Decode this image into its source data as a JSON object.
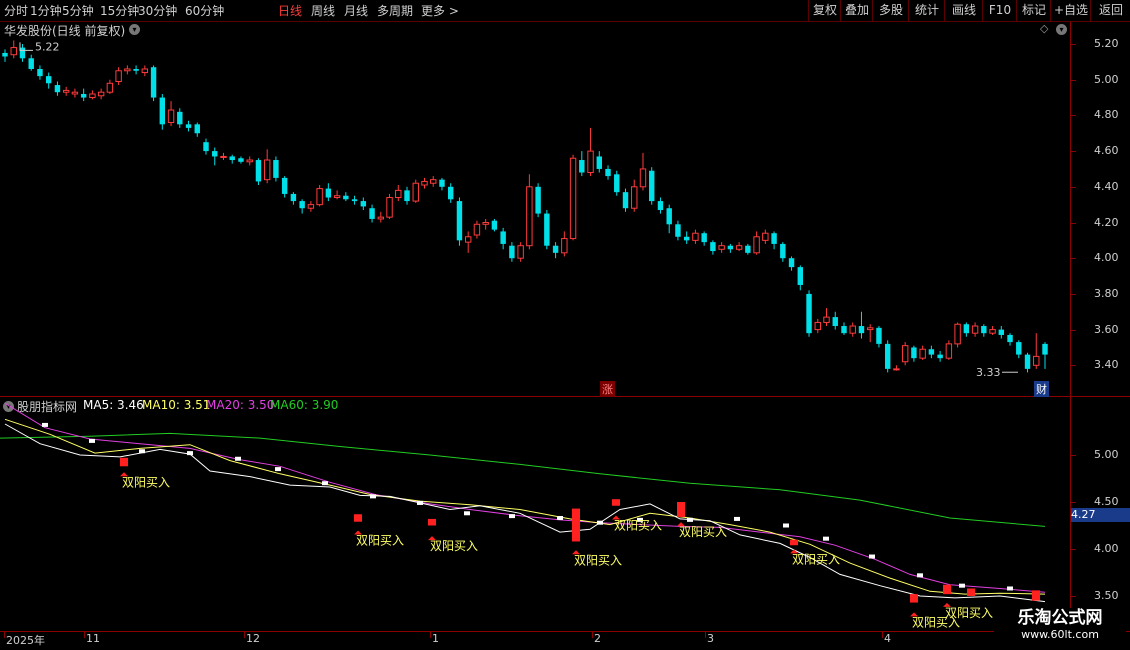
{
  "toolbar": {
    "left": [
      "分时",
      "1分钟",
      "5分钟",
      "15分钟",
      "30分钟",
      "60分钟",
      "日线",
      "周线",
      "月线",
      "多周期",
      "更多 >"
    ],
    "active": "日线",
    "right": [
      "复权",
      "叠加",
      "多股",
      "统计",
      "画线",
      "F10",
      "标记",
      "+自选",
      "返回"
    ]
  },
  "main_panel": {
    "title": "华发股份(日线 前复权)",
    "high_label": "5.22",
    "low_label": "3.33",
    "zhang_badge": "涨",
    "cai_badge": "财",
    "y_ticks": [
      "5.20",
      "5.00",
      "4.80",
      "4.60",
      "4.40",
      "4.20",
      "4.00",
      "3.80",
      "3.60",
      "3.40"
    ]
  },
  "sub_panel": {
    "title": "股朋指标网",
    "ma5": "MA5: 3.46",
    "ma10": "MA10: 3.51",
    "ma20": "MA20: 3.50",
    "ma60": "MA60: 3.90",
    "current_value": "4.27",
    "y_ticks": [
      "5.00",
      "4.50",
      "4.00",
      "3.50"
    ],
    "signal_text": "双阳买入"
  },
  "x_axis": [
    "2025年",
    "11",
    "12",
    "1",
    "2",
    "3",
    "4"
  ],
  "watermark": {
    "line1": "乐淘公式网",
    "line2": "www.60lt.com"
  },
  "colors": {
    "up": "#ff3b3b",
    "down": "#00e0e8",
    "ma5": "#ffffff",
    "ma10": "#ffff66",
    "ma20": "#e040e0",
    "ma60": "#22cc22"
  },
  "chart_data": {
    "type": "candlestick",
    "candles": [
      [
        5.15,
        5.13,
        5.17,
        5.1
      ],
      [
        5.14,
        5.18,
        5.22,
        5.12
      ],
      [
        5.18,
        5.12,
        5.2,
        5.1
      ],
      [
        5.12,
        5.06,
        5.14,
        5.05
      ],
      [
        5.06,
        5.02,
        5.08,
        5.0
      ],
      [
        5.02,
        4.98,
        5.04,
        4.95
      ],
      [
        4.97,
        4.93,
        4.99,
        4.91
      ],
      [
        4.93,
        4.94,
        4.96,
        4.91
      ],
      [
        4.92,
        4.93,
        4.95,
        4.9
      ],
      [
        4.92,
        4.9,
        4.95,
        4.88
      ],
      [
        4.9,
        4.92,
        4.94,
        4.89
      ],
      [
        4.91,
        4.93,
        4.95,
        4.89
      ],
      [
        4.93,
        4.98,
        5.0,
        4.92
      ],
      [
        4.99,
        5.05,
        5.07,
        4.97
      ],
      [
        5.05,
        5.06,
        5.08,
        5.03
      ],
      [
        5.06,
        5.05,
        5.08,
        5.03
      ],
      [
        5.04,
        5.06,
        5.08,
        5.02
      ],
      [
        5.07,
        4.9,
        5.08,
        4.88
      ],
      [
        4.9,
        4.75,
        4.92,
        4.72
      ],
      [
        4.76,
        4.83,
        4.88,
        4.74
      ],
      [
        4.82,
        4.75,
        4.84,
        4.73
      ],
      [
        4.75,
        4.73,
        4.77,
        4.71
      ],
      [
        4.75,
        4.7,
        4.76,
        4.68
      ],
      [
        4.65,
        4.6,
        4.67,
        4.58
      ],
      [
        4.6,
        4.57,
        4.62,
        4.52
      ],
      [
        4.57,
        4.57,
        4.59,
        4.55
      ],
      [
        4.57,
        4.55,
        4.58,
        4.53
      ],
      [
        4.56,
        4.54,
        4.57,
        4.53
      ],
      [
        4.54,
        4.55,
        4.57,
        4.52
      ],
      [
        4.55,
        4.43,
        4.56,
        4.41
      ],
      [
        4.44,
        4.55,
        4.61,
        4.42
      ],
      [
        4.55,
        4.45,
        4.57,
        4.43
      ],
      [
        4.45,
        4.36,
        4.46,
        4.34
      ],
      [
        4.36,
        4.32,
        4.37,
        4.3
      ],
      [
        4.32,
        4.28,
        4.33,
        4.25
      ],
      [
        4.28,
        4.3,
        4.32,
        4.26
      ],
      [
        4.3,
        4.39,
        4.41,
        4.29
      ],
      [
        4.39,
        4.34,
        4.42,
        4.32
      ],
      [
        4.34,
        4.35,
        4.38,
        4.33
      ],
      [
        4.35,
        4.33,
        4.37,
        4.32
      ],
      [
        4.33,
        4.32,
        4.35,
        4.3
      ],
      [
        4.32,
        4.29,
        4.34,
        4.27
      ],
      [
        4.28,
        4.22,
        4.3,
        4.2
      ],
      [
        4.22,
        4.23,
        4.26,
        4.2
      ],
      [
        4.23,
        4.34,
        4.36,
        4.22
      ],
      [
        4.34,
        4.38,
        4.41,
        4.32
      ],
      [
        4.38,
        4.32,
        4.4,
        4.3
      ],
      [
        4.32,
        4.42,
        4.44,
        4.31
      ],
      [
        4.41,
        4.43,
        4.45,
        4.39
      ],
      [
        4.42,
        4.44,
        4.46,
        4.4
      ],
      [
        4.44,
        4.4,
        4.45,
        4.38
      ],
      [
        4.4,
        4.33,
        4.42,
        4.31
      ],
      [
        4.32,
        4.1,
        4.34,
        4.07
      ],
      [
        4.09,
        4.12,
        4.15,
        4.03
      ],
      [
        4.13,
        4.19,
        4.21,
        4.11
      ],
      [
        4.19,
        4.2,
        4.22,
        4.16
      ],
      [
        4.21,
        4.16,
        4.22,
        4.15
      ],
      [
        4.15,
        4.08,
        4.17,
        4.05
      ],
      [
        4.07,
        4.0,
        4.09,
        3.98
      ],
      [
        4.0,
        4.07,
        4.09,
        3.98
      ],
      [
        4.07,
        4.4,
        4.47,
        4.05
      ],
      [
        4.4,
        4.25,
        4.42,
        4.23
      ],
      [
        4.25,
        4.07,
        4.27,
        4.05
      ],
      [
        4.07,
        4.03,
        4.09,
        4.0
      ],
      [
        4.03,
        4.11,
        4.15,
        4.01
      ],
      [
        4.11,
        4.56,
        4.58,
        4.1
      ],
      [
        4.55,
        4.48,
        4.6,
        4.46
      ],
      [
        4.48,
        4.6,
        4.73,
        4.46
      ],
      [
        4.57,
        4.5,
        4.6,
        4.48
      ],
      [
        4.5,
        4.46,
        4.52,
        4.44
      ],
      [
        4.47,
        4.37,
        4.49,
        4.35
      ],
      [
        4.37,
        4.28,
        4.39,
        4.26
      ],
      [
        4.28,
        4.4,
        4.44,
        4.26
      ],
      [
        4.4,
        4.5,
        4.59,
        4.38
      ],
      [
        4.49,
        4.32,
        4.51,
        4.3
      ],
      [
        4.32,
        4.27,
        4.34,
        4.25
      ],
      [
        4.28,
        4.19,
        4.3,
        4.14
      ],
      [
        4.19,
        4.12,
        4.21,
        4.1
      ],
      [
        4.12,
        4.1,
        4.15,
        4.08
      ],
      [
        4.1,
        4.14,
        4.16,
        4.08
      ],
      [
        4.14,
        4.09,
        4.15,
        4.07
      ],
      [
        4.09,
        4.04,
        4.1,
        4.02
      ],
      [
        4.05,
        4.07,
        4.09,
        4.03
      ],
      [
        4.07,
        4.05,
        4.08,
        4.03
      ],
      [
        4.05,
        4.07,
        4.09,
        4.04
      ],
      [
        4.07,
        4.03,
        4.08,
        4.02
      ],
      [
        4.03,
        4.12,
        4.15,
        4.02
      ],
      [
        4.1,
        4.14,
        4.16,
        4.08
      ],
      [
        4.14,
        4.08,
        4.15,
        4.05
      ],
      [
        4.08,
        4.0,
        4.09,
        3.98
      ],
      [
        4.0,
        3.95,
        4.01,
        3.93
      ],
      [
        3.95,
        3.85,
        3.96,
        3.82
      ],
      [
        3.8,
        3.58,
        3.82,
        3.56
      ],
      [
        3.6,
        3.64,
        3.66,
        3.58
      ],
      [
        3.64,
        3.67,
        3.72,
        3.62
      ],
      [
        3.67,
        3.62,
        3.7,
        3.6
      ],
      [
        3.62,
        3.58,
        3.64,
        3.57
      ],
      [
        3.58,
        3.62,
        3.64,
        3.56
      ],
      [
        3.62,
        3.58,
        3.7,
        3.55
      ],
      [
        3.6,
        3.61,
        3.63,
        3.53
      ],
      [
        3.61,
        3.52,
        3.62,
        3.5
      ],
      [
        3.52,
        3.38,
        3.54,
        3.36
      ],
      [
        3.38,
        3.38,
        3.4,
        3.37
      ],
      [
        3.42,
        3.51,
        3.53,
        3.4
      ],
      [
        3.5,
        3.44,
        3.51,
        3.42
      ],
      [
        3.44,
        3.49,
        3.51,
        3.43
      ],
      [
        3.49,
        3.46,
        3.51,
        3.44
      ],
      [
        3.46,
        3.44,
        3.48,
        3.42
      ],
      [
        3.44,
        3.52,
        3.54,
        3.43
      ],
      [
        3.52,
        3.63,
        3.64,
        3.5
      ],
      [
        3.63,
        3.58,
        3.64,
        3.56
      ],
      [
        3.58,
        3.62,
        3.64,
        3.56
      ],
      [
        3.62,
        3.58,
        3.63,
        3.56
      ],
      [
        3.58,
        3.6,
        3.62,
        3.57
      ],
      [
        3.6,
        3.57,
        3.62,
        3.55
      ],
      [
        3.57,
        3.53,
        3.58,
        3.51
      ],
      [
        3.53,
        3.46,
        3.54,
        3.44
      ],
      [
        3.46,
        3.38,
        3.47,
        3.36
      ],
      [
        3.4,
        3.45,
        3.58,
        3.38
      ],
      [
        3.52,
        3.46,
        3.53,
        3.38
      ]
    ],
    "y_range_main": [
      3.33,
      5.22
    ],
    "sub_lines": {
      "ma60": [
        [
          0,
          5.18
        ],
        [
          90,
          5.2
        ],
        [
          170,
          5.23
        ],
        [
          260,
          5.18
        ],
        [
          340,
          5.09
        ],
        [
          430,
          5.0
        ],
        [
          520,
          4.9
        ],
        [
          600,
          4.8
        ],
        [
          690,
          4.7
        ],
        [
          780,
          4.63
        ],
        [
          860,
          4.52
        ],
        [
          950,
          4.33
        ],
        [
          1045,
          4.24
        ]
      ],
      "ma20": [
        [
          5,
          5.55
        ],
        [
          45,
          5.29
        ],
        [
          90,
          5.17
        ],
        [
          140,
          5.12
        ],
        [
          190,
          5.07
        ],
        [
          240,
          4.95
        ],
        [
          280,
          4.88
        ],
        [
          330,
          4.71
        ],
        [
          375,
          4.58
        ],
        [
          430,
          4.48
        ],
        [
          470,
          4.42
        ],
        [
          515,
          4.36
        ],
        [
          560,
          4.31
        ],
        [
          600,
          4.28
        ],
        [
          640,
          4.26
        ],
        [
          680,
          4.24
        ],
        [
          720,
          4.23
        ],
        [
          760,
          4.18
        ],
        [
          800,
          4.13
        ],
        [
          835,
          4.04
        ],
        [
          875,
          3.89
        ],
        [
          910,
          3.73
        ],
        [
          950,
          3.62
        ],
        [
          1000,
          3.58
        ],
        [
          1045,
          3.54
        ]
      ],
      "ma10": [
        [
          5,
          5.38
        ],
        [
          50,
          5.22
        ],
        [
          95,
          5.02
        ],
        [
          140,
          5.07
        ],
        [
          190,
          5.11
        ],
        [
          230,
          4.94
        ],
        [
          280,
          4.8
        ],
        [
          330,
          4.68
        ],
        [
          370,
          4.58
        ],
        [
          420,
          4.51
        ],
        [
          470,
          4.47
        ],
        [
          520,
          4.42
        ],
        [
          570,
          4.32
        ],
        [
          610,
          4.26
        ],
        [
          650,
          4.38
        ],
        [
          690,
          4.33
        ],
        [
          730,
          4.26
        ],
        [
          770,
          4.18
        ],
        [
          810,
          4.05
        ],
        [
          850,
          3.85
        ],
        [
          890,
          3.69
        ],
        [
          930,
          3.55
        ],
        [
          965,
          3.52
        ],
        [
          1000,
          3.53
        ],
        [
          1045,
          3.52
        ]
      ],
      "ma5": [
        [
          5,
          5.33
        ],
        [
          40,
          5.12
        ],
        [
          80,
          5.0
        ],
        [
          120,
          4.98
        ],
        [
          160,
          5.06
        ],
        [
          190,
          5.01
        ],
        [
          210,
          4.83
        ],
        [
          250,
          4.77
        ],
        [
          290,
          4.68
        ],
        [
          330,
          4.66
        ],
        [
          360,
          4.57
        ],
        [
          390,
          4.56
        ],
        [
          420,
          4.49
        ],
        [
          450,
          4.42
        ],
        [
          480,
          4.46
        ],
        [
          520,
          4.38
        ],
        [
          560,
          4.18
        ],
        [
          590,
          4.21
        ],
        [
          620,
          4.42
        ],
        [
          650,
          4.48
        ],
        [
          680,
          4.32
        ],
        [
          710,
          4.3
        ],
        [
          740,
          4.15
        ],
        [
          780,
          4.06
        ],
        [
          810,
          3.91
        ],
        [
          840,
          3.73
        ],
        [
          880,
          3.61
        ],
        [
          920,
          3.5
        ],
        [
          955,
          3.48
        ],
        [
          1000,
          3.5
        ],
        [
          1045,
          3.44
        ]
      ]
    },
    "sub_markers": [
      {
        "x": 45,
        "y": 5.32,
        "c": "w"
      },
      {
        "x": 92,
        "y": 5.15,
        "c": "w"
      },
      {
        "x": 142,
        "y": 5.04,
        "c": "w"
      },
      {
        "x": 190,
        "y": 5.02,
        "c": "w"
      },
      {
        "x": 238,
        "y": 4.96,
        "c": "w"
      },
      {
        "x": 278,
        "y": 4.85,
        "c": "w"
      },
      {
        "x": 325,
        "y": 4.7,
        "c": "w"
      },
      {
        "x": 373,
        "y": 4.56,
        "c": "w"
      },
      {
        "x": 420,
        "y": 4.49,
        "c": "w"
      },
      {
        "x": 467,
        "y": 4.38,
        "c": "w"
      },
      {
        "x": 512,
        "y": 4.35,
        "c": "w"
      },
      {
        "x": 560,
        "y": 4.33,
        "c": "w"
      },
      {
        "x": 600,
        "y": 4.28,
        "c": "w"
      },
      {
        "x": 640,
        "y": 4.31,
        "c": "w"
      },
      {
        "x": 690,
        "y": 4.31,
        "c": "w"
      },
      {
        "x": 737,
        "y": 4.32,
        "c": "w"
      },
      {
        "x": 786,
        "y": 4.25,
        "c": "w"
      },
      {
        "x": 826,
        "y": 4.11,
        "c": "w"
      },
      {
        "x": 872,
        "y": 3.92,
        "c": "w"
      },
      {
        "x": 920,
        "y": 3.72,
        "c": "w"
      },
      {
        "x": 962,
        "y": 3.61,
        "c": "w"
      },
      {
        "x": 1010,
        "y": 3.58,
        "c": "w"
      }
    ],
    "red_bars": [
      [
        124,
        4.88,
        4.97
      ],
      [
        358,
        4.29,
        4.37
      ],
      [
        432,
        4.25,
        4.32
      ],
      [
        576,
        4.08,
        4.43
      ],
      [
        616,
        4.46,
        4.53
      ],
      [
        681,
        4.34,
        4.5
      ],
      [
        794,
        4.04,
        4.1
      ],
      [
        914,
        3.43,
        3.52
      ],
      [
        947,
        3.52,
        3.62
      ],
      [
        971,
        3.5,
        3.58
      ],
      [
        1036,
        3.45,
        3.56
      ]
    ],
    "signals": [
      [
        124,
        4.71
      ],
      [
        358,
        4.09
      ],
      [
        432,
        4.03
      ],
      [
        576,
        3.88
      ],
      [
        616,
        4.25
      ],
      [
        681,
        4.18
      ],
      [
        794,
        3.89
      ],
      [
        914,
        3.22
      ],
      [
        947,
        3.32
      ]
    ]
  }
}
